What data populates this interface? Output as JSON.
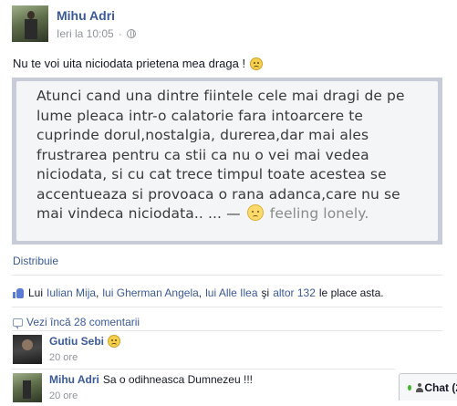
{
  "post": {
    "author": "Mihu Adri",
    "timestamp": "Ieri la 10:05",
    "meta_separator": "·",
    "text": "Nu te voi uita niciodata prietena mea draga !",
    "image_text_lines": [
      "Atunci cand una dintre fiintele cele mai dragi de pe",
      "lume pleaca intr-o calatorie fara intoarcere te",
      "cuprinde dorul,nostalgia, durerea,dar mai ales",
      "frustrarea pentru ca stii ca nu o vei mai vedea",
      "niciodata, si cu cat trece timpul toate acestea se",
      "accentueaza si provoaca o rana adanca,care nu se"
    ],
    "image_last_line": "mai vindeca niciodata.. ... —",
    "image_feeling": "feeling lonely.",
    "share_label": "Distribuie"
  },
  "likes": {
    "prefix": "Lui",
    "people": [
      "Iulian Mija",
      "lui Gherman Angela",
      "lui Alle Ilea"
    ],
    "separator": ",",
    "conjunction": "şi",
    "others": "altor 132",
    "suffix": "le place asta."
  },
  "comments_section": {
    "more_comments": "Vezi încă 28 comentarii",
    "comments": [
      {
        "author": "Gutiu Sebi",
        "text": "",
        "time": "20 ore"
      },
      {
        "author": "Mihu Adri",
        "text": "Sa o odihneasca Dumnezeu !!!",
        "time": "20 ore"
      }
    ]
  },
  "chat": {
    "label": "Chat (2"
  },
  "icons": {
    "globe": "globe-icon",
    "smiley": "sad-emoji-icon",
    "like": "thumbs-up-icon",
    "comment": "comment-bubble-icon",
    "chat_person": "person-icon"
  },
  "colors": {
    "link": "#3b5998",
    "meta": "#90949c",
    "online": "#42b72a"
  }
}
